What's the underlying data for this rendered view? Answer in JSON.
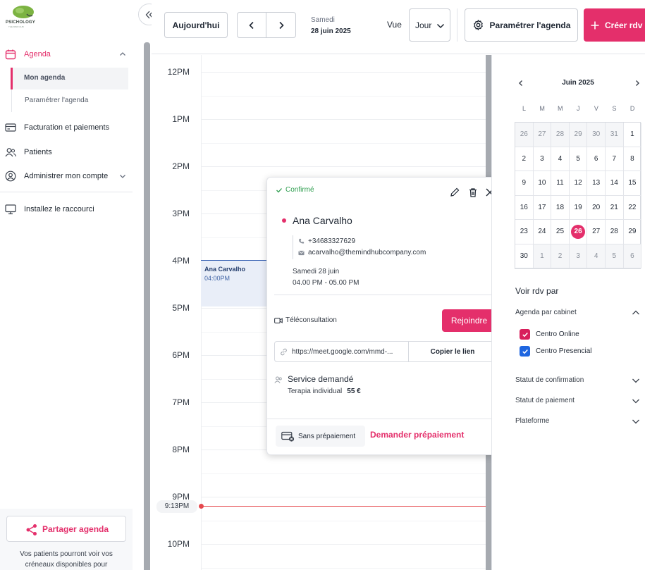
{
  "brand": {
    "logo_text": "PSICHOLOGY",
    "logo_sub": "THE MIND HUB"
  },
  "sidebar": {
    "agenda": "Agenda",
    "mon_agenda": "Mon agenda",
    "parametrer": "Paramétrer l'agenda",
    "facturation": "Facturation et paiements",
    "patients": "Patients",
    "administrer": "Administrer mon compte",
    "raccourci": "Installez le raccourci",
    "share_button": "Partager agenda",
    "share_desc": "Vos patients pourront voir vos créneaux disponibles pour"
  },
  "toolbar": {
    "today": "Aujourd'hui",
    "weekday": "Samedi",
    "date": "28 juin 2025",
    "vue_label": "Vue",
    "vue_value": "Jour",
    "param_button": "Paramétrer l'agenda",
    "create_button": "Créer rdv"
  },
  "calendar": {
    "hours": [
      "12PM",
      "1PM",
      "2PM",
      "3PM",
      "4PM",
      "5PM",
      "6PM",
      "7PM",
      "8PM",
      "9PM",
      "10PM"
    ],
    "now_label": "9:13PM",
    "event": {
      "name": "Ana Carvalho",
      "time": "04:00PM"
    }
  },
  "popup": {
    "status": "Confirmé",
    "patient_name": "Ana Carvalho",
    "phone": "+34683327629",
    "email": "acarvalho@themindhubcompany.com",
    "date": "Samedi 28 juin",
    "time": "04.00 PM - 05.00 PM",
    "mode": "Téléconsultation",
    "join_button": "Rejoindre",
    "link": "https://meet.google.com/mmd-...",
    "copy_button": "Copier le lien",
    "service_title": "Service demandé",
    "service_name": "Terapia individual",
    "service_price": "55 €",
    "prepay_status": "Sans prépaiement",
    "prepay_request": "Demander prépaiement"
  },
  "mini_calendar": {
    "title": "Juin 2025",
    "day_headers": [
      "L",
      "M",
      "M",
      "J",
      "V",
      "S",
      "D"
    ],
    "weeks": [
      [
        "26",
        "27",
        "28",
        "29",
        "30",
        "31",
        "1"
      ],
      [
        "2",
        "3",
        "4",
        "5",
        "6",
        "7",
        "8"
      ],
      [
        "9",
        "10",
        "11",
        "12",
        "13",
        "14",
        "15"
      ],
      [
        "16",
        "17",
        "18",
        "19",
        "20",
        "21",
        "22"
      ],
      [
        "23",
        "24",
        "25",
        "26",
        "27",
        "28",
        "29"
      ],
      [
        "30",
        "1",
        "2",
        "3",
        "4",
        "5",
        "6"
      ]
    ],
    "today": "26"
  },
  "filters": {
    "title": "Voir rdv par",
    "cabinet": "Agenda par cabinet",
    "online": "Centro Online",
    "presencial": "Centro Presencial",
    "confirmation": "Statut de confirmation",
    "paiement": "Statut de paiement",
    "plateforme": "Plateforme"
  },
  "colors": {
    "accent": "#e42f6b",
    "confirmed": "#2e9e4f",
    "event": "#2f5ab0",
    "now": "#e5484d",
    "online": "#d81e5b",
    "presencial": "#1f66e0"
  }
}
